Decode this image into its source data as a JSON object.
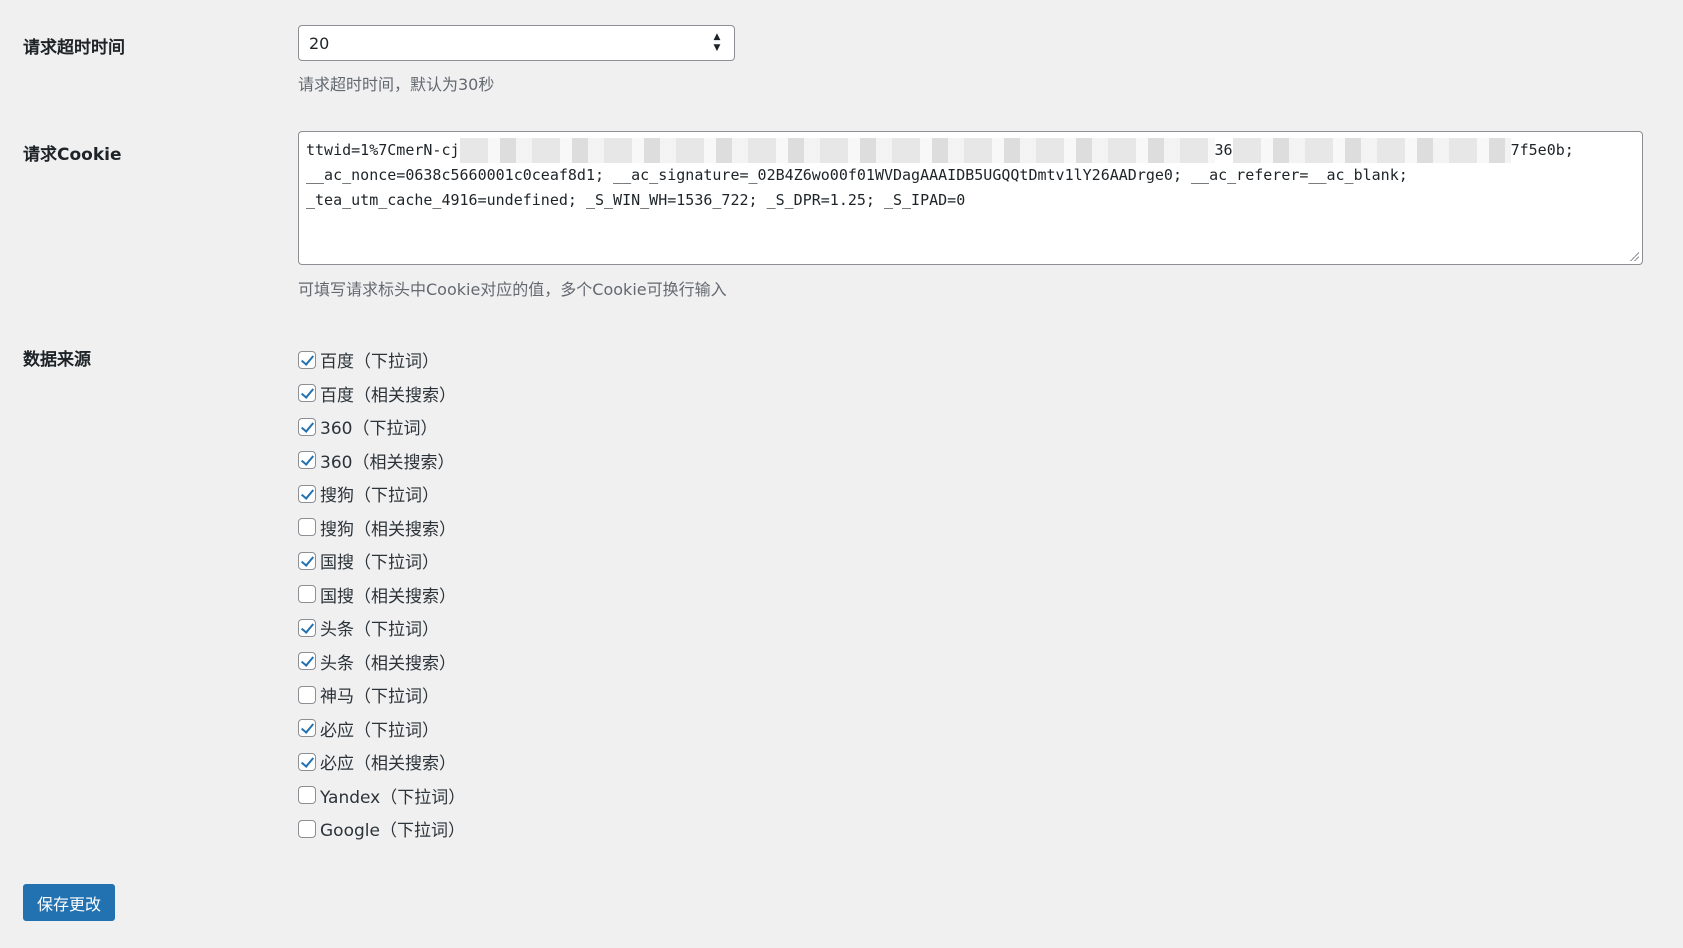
{
  "timeout": {
    "label": "请求超时时间",
    "value": "20",
    "description": "请求超时时间，默认为30秒"
  },
  "cookie": {
    "label": "请求Cookie",
    "line1_start": "ttwid=1%7CmerN-cj",
    "line1_mid": "36",
    "line1_end": "7f5e0b;",
    "line2": "__ac_nonce=0638c5660001c0ceaf8d1; __ac_signature=_02B4Z6wo00f01WVDagAAAIDB5UGQQtDmtv1lY26AADrge0; __ac_referer=__ac_blank;",
    "line3": "_tea_utm_cache_4916=undefined; _S_WIN_WH=1536_722; _S_DPR=1.25; _S_IPAD=0",
    "description": "可填写请求标头中Cookie对应的值，多个Cookie可换行输入"
  },
  "sources": {
    "label": "数据来源",
    "items": [
      {
        "label": "百度（下拉词）",
        "checked": true
      },
      {
        "label": "百度（相关搜索）",
        "checked": true
      },
      {
        "label": "360（下拉词）",
        "checked": true
      },
      {
        "label": "360（相关搜索）",
        "checked": true
      },
      {
        "label": "搜狗（下拉词）",
        "checked": true
      },
      {
        "label": "搜狗（相关搜索）",
        "checked": false
      },
      {
        "label": "国搜（下拉词）",
        "checked": true
      },
      {
        "label": "国搜（相关搜索）",
        "checked": false
      },
      {
        "label": "头条（下拉词）",
        "checked": true
      },
      {
        "label": "头条（相关搜索）",
        "checked": true
      },
      {
        "label": "神马（下拉词）",
        "checked": false
      },
      {
        "label": "必应（下拉词）",
        "checked": true
      },
      {
        "label": "必应（相关搜索）",
        "checked": true
      },
      {
        "label": "Yandex（下拉词）",
        "checked": false
      },
      {
        "label": "Google（下拉词）",
        "checked": false
      }
    ]
  },
  "save_button": "保存更改",
  "colors": {
    "background": "#f0f0f1",
    "accent": "#2271b1",
    "border": "#8c8f94",
    "description": "#646970"
  }
}
